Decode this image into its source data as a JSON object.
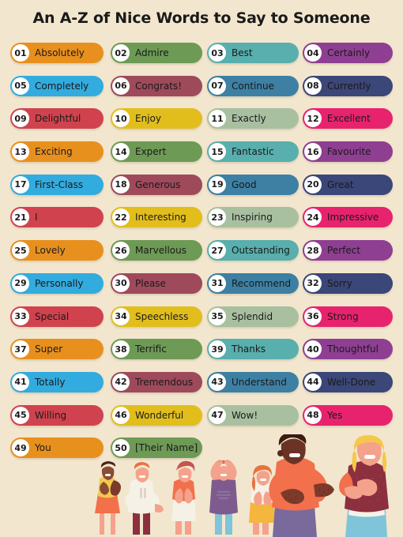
{
  "title": "An A-Z of Nice Words to Say to Someone",
  "background_color": "#F2E6CE",
  "palette": {
    "orange": "#E8901E",
    "green": "#6D9A55",
    "teal": "#58AFAD",
    "purple": "#8F3F92",
    "skyblue": "#32ABDF",
    "maroon": "#9E4A5B",
    "steelblue": "#3D80A3",
    "navy": "#3B4679",
    "red": "#D0434E",
    "yellow": "#E2BE1C",
    "sage": "#A8C0A0",
    "pink": "#E8236E"
  },
  "columns": 4,
  "items": [
    {
      "num": "01",
      "word": "Absolutely",
      "color": "#E8901E",
      "col": 0,
      "row": 0
    },
    {
      "num": "02",
      "word": "Admire",
      "color": "#6D9A55",
      "col": 1,
      "row": 0
    },
    {
      "num": "03",
      "word": "Best",
      "color": "#58AFAD",
      "col": 2,
      "row": 0
    },
    {
      "num": "04",
      "word": "Certainly",
      "color": "#8F3F92",
      "col": 3,
      "row": 0
    },
    {
      "num": "05",
      "word": "Completely",
      "color": "#32ABDF",
      "col": 0,
      "row": 1
    },
    {
      "num": "06",
      "word": "Congrats!",
      "color": "#9E4A5B",
      "col": 1,
      "row": 1
    },
    {
      "num": "07",
      "word": "Continue",
      "color": "#3D80A3",
      "col": 2,
      "row": 1
    },
    {
      "num": "08",
      "word": "Currently",
      "color": "#3B4679",
      "col": 3,
      "row": 1
    },
    {
      "num": "09",
      "word": "Delightful",
      "color": "#D0434E",
      "col": 0,
      "row": 2
    },
    {
      "num": "10",
      "word": "Enjoy",
      "color": "#E2BE1C",
      "col": 1,
      "row": 2
    },
    {
      "num": "11",
      "word": "Exactly",
      "color": "#A8C0A0",
      "col": 2,
      "row": 2
    },
    {
      "num": "12",
      "word": "Excellent",
      "color": "#E8236E",
      "col": 3,
      "row": 2
    },
    {
      "num": "13",
      "word": "Exciting",
      "color": "#E8901E",
      "col": 0,
      "row": 3
    },
    {
      "num": "14",
      "word": "Expert",
      "color": "#6D9A55",
      "col": 1,
      "row": 3
    },
    {
      "num": "15",
      "word": "Fantastic",
      "color": "#58AFAD",
      "col": 2,
      "row": 3
    },
    {
      "num": "16",
      "word": "Favourite",
      "color": "#8F3F92",
      "col": 3,
      "row": 3
    },
    {
      "num": "17",
      "word": "First-Class",
      "color": "#32ABDF",
      "col": 0,
      "row": 4
    },
    {
      "num": "18",
      "word": "Generous",
      "color": "#9E4A5B",
      "col": 1,
      "row": 4
    },
    {
      "num": "19",
      "word": "Good",
      "color": "#3D80A3",
      "col": 2,
      "row": 4
    },
    {
      "num": "20",
      "word": "Great",
      "color": "#3B4679",
      "col": 3,
      "row": 4
    },
    {
      "num": "21",
      "word": "I",
      "color": "#D0434E",
      "col": 0,
      "row": 5
    },
    {
      "num": "22",
      "word": "Interesting",
      "color": "#E2BE1C",
      "col": 1,
      "row": 5
    },
    {
      "num": "23",
      "word": "Inspiring",
      "color": "#A8C0A0",
      "col": 2,
      "row": 5
    },
    {
      "num": "24",
      "word": "Impressive",
      "color": "#E8236E",
      "col": 3,
      "row": 5
    },
    {
      "num": "25",
      "word": "Lovely",
      "color": "#E8901E",
      "col": 0,
      "row": 6
    },
    {
      "num": "26",
      "word": "Marvellous",
      "color": "#6D9A55",
      "col": 1,
      "row": 6
    },
    {
      "num": "27",
      "word": "Outstanding",
      "color": "#58AFAD",
      "col": 2,
      "row": 6
    },
    {
      "num": "28",
      "word": "Perfect",
      "color": "#8F3F92",
      "col": 3,
      "row": 6
    },
    {
      "num": "29",
      "word": "Personally",
      "color": "#32ABDF",
      "col": 0,
      "row": 7
    },
    {
      "num": "30",
      "word": "Please",
      "color": "#9E4A5B",
      "col": 1,
      "row": 7
    },
    {
      "num": "31",
      "word": "Recommend",
      "color": "#3D80A3",
      "col": 2,
      "row": 7
    },
    {
      "num": "32",
      "word": "Sorry",
      "color": "#3B4679",
      "col": 3,
      "row": 7
    },
    {
      "num": "33",
      "word": "Special",
      "color": "#D0434E",
      "col": 0,
      "row": 8
    },
    {
      "num": "34",
      "word": "Speechless",
      "color": "#E2BE1C",
      "col": 1,
      "row": 8
    },
    {
      "num": "35",
      "word": "Splendid",
      "color": "#A8C0A0",
      "col": 2,
      "row": 8
    },
    {
      "num": "36",
      "word": "Strong",
      "color": "#E8236E",
      "col": 3,
      "row": 8
    },
    {
      "num": "37",
      "word": "Super",
      "color": "#E8901E",
      "col": 0,
      "row": 9
    },
    {
      "num": "38",
      "word": "Terrific",
      "color": "#6D9A55",
      "col": 1,
      "row": 9
    },
    {
      "num": "39",
      "word": "Thanks",
      "color": "#58AFAD",
      "col": 2,
      "row": 9
    },
    {
      "num": "40",
      "word": "Thoughtful",
      "color": "#8F3F92",
      "col": 3,
      "row": 9
    },
    {
      "num": "41",
      "word": "Totally",
      "color": "#32ABDF",
      "col": 0,
      "row": 10
    },
    {
      "num": "42",
      "word": "Tremendous",
      "color": "#9E4A5B",
      "col": 1,
      "row": 10
    },
    {
      "num": "43",
      "word": "Understand",
      "color": "#3D80A3",
      "col": 2,
      "row": 10
    },
    {
      "num": "44",
      "word": "Well-Done",
      "color": "#3B4679",
      "col": 3,
      "row": 10
    },
    {
      "num": "45",
      "word": "Willing",
      "color": "#D0434E",
      "col": 0,
      "row": 11
    },
    {
      "num": "46",
      "word": "Wonderful",
      "color": "#E2BE1C",
      "col": 1,
      "row": 11
    },
    {
      "num": "47",
      "word": "Wow!",
      "color": "#A8C0A0",
      "col": 2,
      "row": 11
    },
    {
      "num": "48",
      "word": "Yes",
      "color": "#E8236E",
      "col": 3,
      "row": 11
    },
    {
      "num": "49",
      "word": "You",
      "color": "#E8901E",
      "col": 0,
      "row": 12
    },
    {
      "num": "50",
      "word": "[Their Name]",
      "color": "#6D9A55",
      "col": 1,
      "row": 12
    }
  ],
  "illustration": {
    "description": "group-of-people-clapping",
    "figure_count": 7
  }
}
